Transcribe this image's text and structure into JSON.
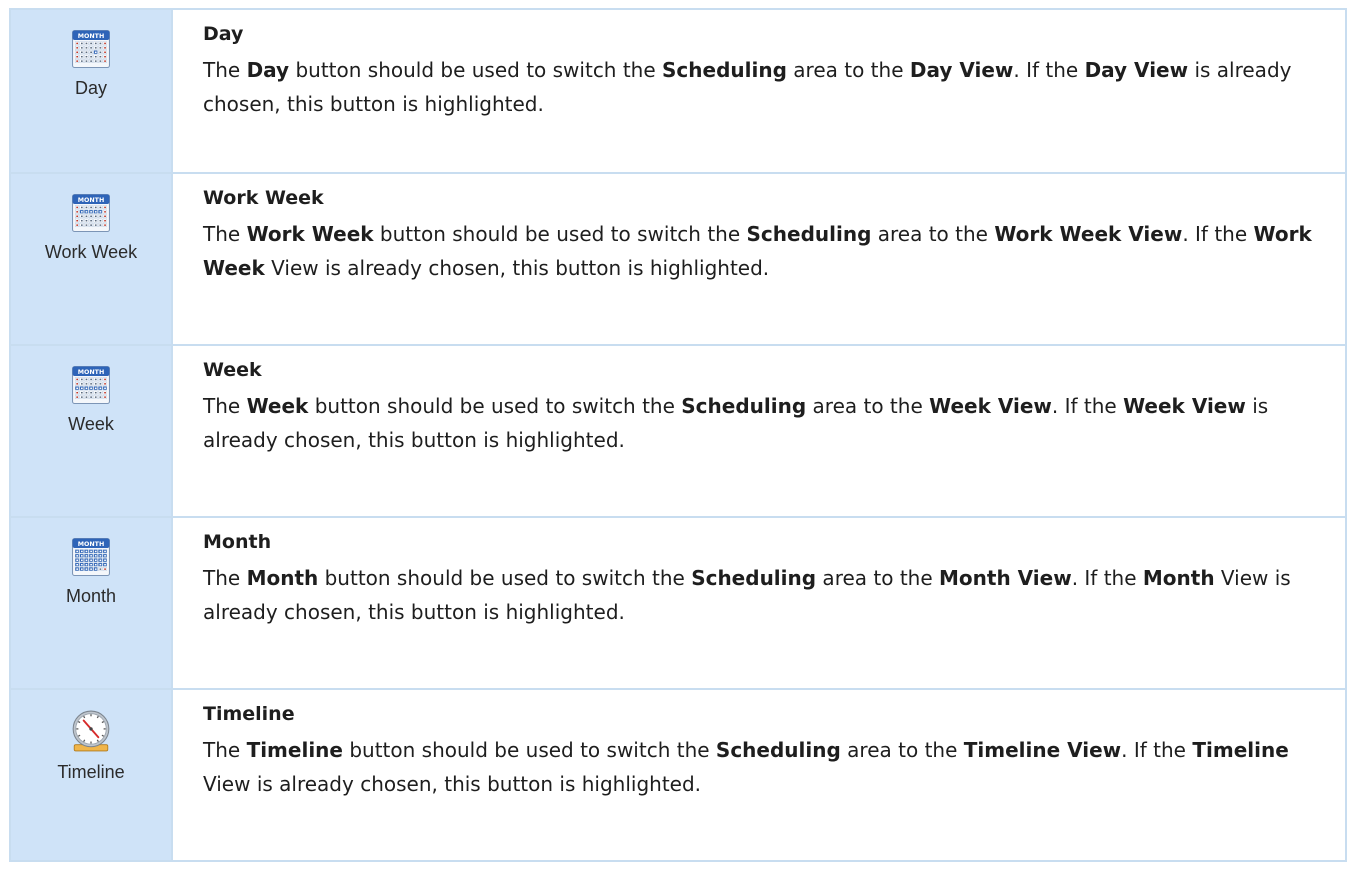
{
  "rows": [
    {
      "icon": "calendar-day-icon",
      "button_label": "Day",
      "title": "Day",
      "desc": [
        {
          "t": "The ",
          "b": false
        },
        {
          "t": "Day",
          "b": true
        },
        {
          "t": " button should be used to switch the ",
          "b": false
        },
        {
          "t": "Scheduling",
          "b": true
        },
        {
          "t": " area to the ",
          "b": false
        },
        {
          "t": "Day View",
          "b": true
        },
        {
          "t": ". If the ",
          "b": false
        },
        {
          "t": "Day View",
          "b": true
        },
        {
          "t": " is already chosen, this button is highlighted.",
          "b": false
        }
      ]
    },
    {
      "icon": "calendar-work-week-icon",
      "button_label": "Work Week",
      "title": "Work Week",
      "desc": [
        {
          "t": "The ",
          "b": false
        },
        {
          "t": "Work Week",
          "b": true
        },
        {
          "t": " button should be used to switch the ",
          "b": false
        },
        {
          "t": "Scheduling",
          "b": true
        },
        {
          "t": " area to the ",
          "b": false
        },
        {
          "t": "Work Week View",
          "b": true
        },
        {
          "t": ". If the ",
          "b": false
        },
        {
          "t": "Work Week",
          "b": true
        },
        {
          "t": " View is already chosen, this button is highlighted.",
          "b": false
        }
      ]
    },
    {
      "icon": "calendar-week-icon",
      "button_label": "Week",
      "title": "Week",
      "desc": [
        {
          "t": "The ",
          "b": false
        },
        {
          "t": "Week",
          "b": true
        },
        {
          "t": " button should be used to switch the ",
          "b": false
        },
        {
          "t": "Scheduling",
          "b": true
        },
        {
          "t": " area to the ",
          "b": false
        },
        {
          "t": "Week View",
          "b": true
        },
        {
          "t": ". If the ",
          "b": false
        },
        {
          "t": "Week View",
          "b": true
        },
        {
          "t": " is already chosen, this button is highlighted.",
          "b": false
        }
      ]
    },
    {
      "icon": "calendar-month-icon",
      "button_label": "Month",
      "title": "Month",
      "desc": [
        {
          "t": "The ",
          "b": false
        },
        {
          "t": "Month",
          "b": true
        },
        {
          "t": " button should be used to switch the ",
          "b": false
        },
        {
          "t": "Scheduling",
          "b": true
        },
        {
          "t": " area to the ",
          "b": false
        },
        {
          "t": "Month View",
          "b": true
        },
        {
          "t": ". If the ",
          "b": false
        },
        {
          "t": "Month",
          "b": true
        },
        {
          "t": " View is already chosen, this button is highlighted.",
          "b": false
        }
      ]
    },
    {
      "icon": "clock-timeline-icon",
      "button_label": "Timeline",
      "title": "Timeline",
      "desc": [
        {
          "t": "The ",
          "b": false
        },
        {
          "t": "Timeline",
          "b": true
        },
        {
          "t": " button should be used to switch the ",
          "b": false
        },
        {
          "t": "Scheduling",
          "b": true
        },
        {
          "t": " area to the ",
          "b": false
        },
        {
          "t": "Timeline View",
          "b": true
        },
        {
          "t": ". If the ",
          "b": false
        },
        {
          "t": "Timeline",
          "b": true
        },
        {
          "t": " View is already chosen, this button is highlighted.",
          "b": false
        }
      ]
    }
  ],
  "calendar_header_text": "MONTH",
  "colors": {
    "icon_cell_bg": "#cfe3f8",
    "border": "#c8ddf0",
    "calendar_header": "#2e64b8",
    "calendar_highlight": "#2e64b8",
    "clock_hand": "#d62a2a"
  }
}
